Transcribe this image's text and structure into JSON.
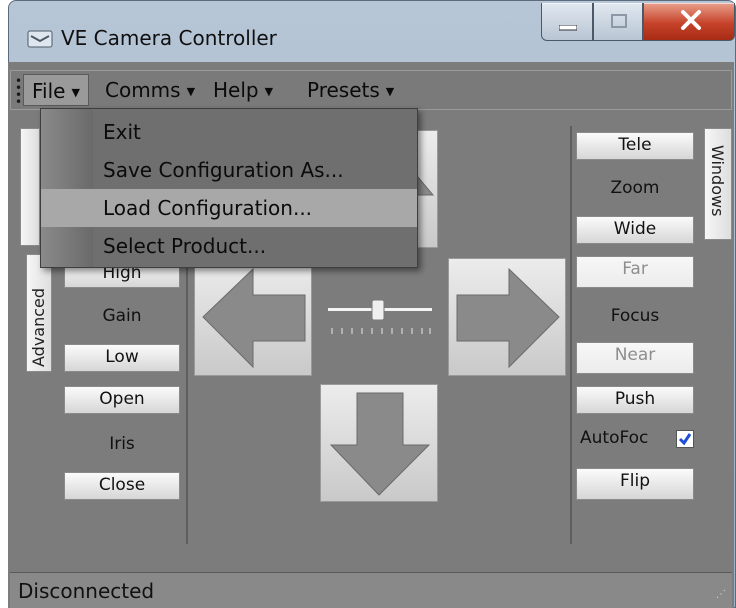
{
  "window": {
    "title": "VE Camera Controller"
  },
  "menu": {
    "file": "File",
    "comms": "Comms",
    "help": "Help",
    "presets": "Presets"
  },
  "file_menu": {
    "items": [
      "Exit",
      "Save Configuration As...",
      "Load Configuration...",
      "Select Product..."
    ],
    "highlighted_index": 2
  },
  "left_panel": {
    "high": "High",
    "gain": "Gain",
    "low": "Low",
    "open": "Open",
    "iris": "Iris",
    "close": "Close",
    "advanced_tab": "Advanced"
  },
  "right_panel": {
    "tele": "Tele",
    "zoom": "Zoom",
    "wide": "Wide",
    "far": "Far",
    "focus": "Focus",
    "near": "Near",
    "push": "Push",
    "autofocus": "AutoFoc",
    "autofocus_checked": true,
    "flip": "Flip",
    "windows_tab": "Windows"
  },
  "status": {
    "text": "Disconnected"
  },
  "colors": {
    "panel_bg": "#7c7c7c",
    "highlight": "#a8a8a8",
    "close_red": "#c6432a",
    "check_blue": "#1f4fd8"
  }
}
